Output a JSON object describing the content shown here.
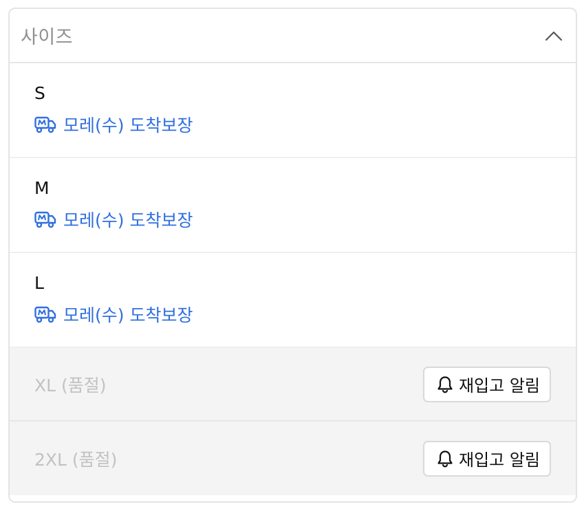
{
  "select": {
    "placeholder": "사이즈",
    "chevron_icon": "chevron-up-icon"
  },
  "options": [
    {
      "size": "S",
      "delivery": "모레(수) 도착보장",
      "icon": "delivery-truck-icon",
      "accent": "#2f6fde"
    },
    {
      "size": "M",
      "delivery": "모레(수) 도착보장",
      "icon": "delivery-truck-icon",
      "accent": "#2f6fde"
    },
    {
      "size": "L",
      "delivery": "모레(수) 도착보장",
      "icon": "delivery-truck-icon",
      "accent": "#2f6fde"
    }
  ],
  "soldout_options": [
    {
      "label": "XL (품절)",
      "button_label": "재입고 알림",
      "icon": "bell-icon"
    },
    {
      "label": "2XL (품절)",
      "button_label": "재입고 알림",
      "icon": "bell-icon"
    }
  ]
}
